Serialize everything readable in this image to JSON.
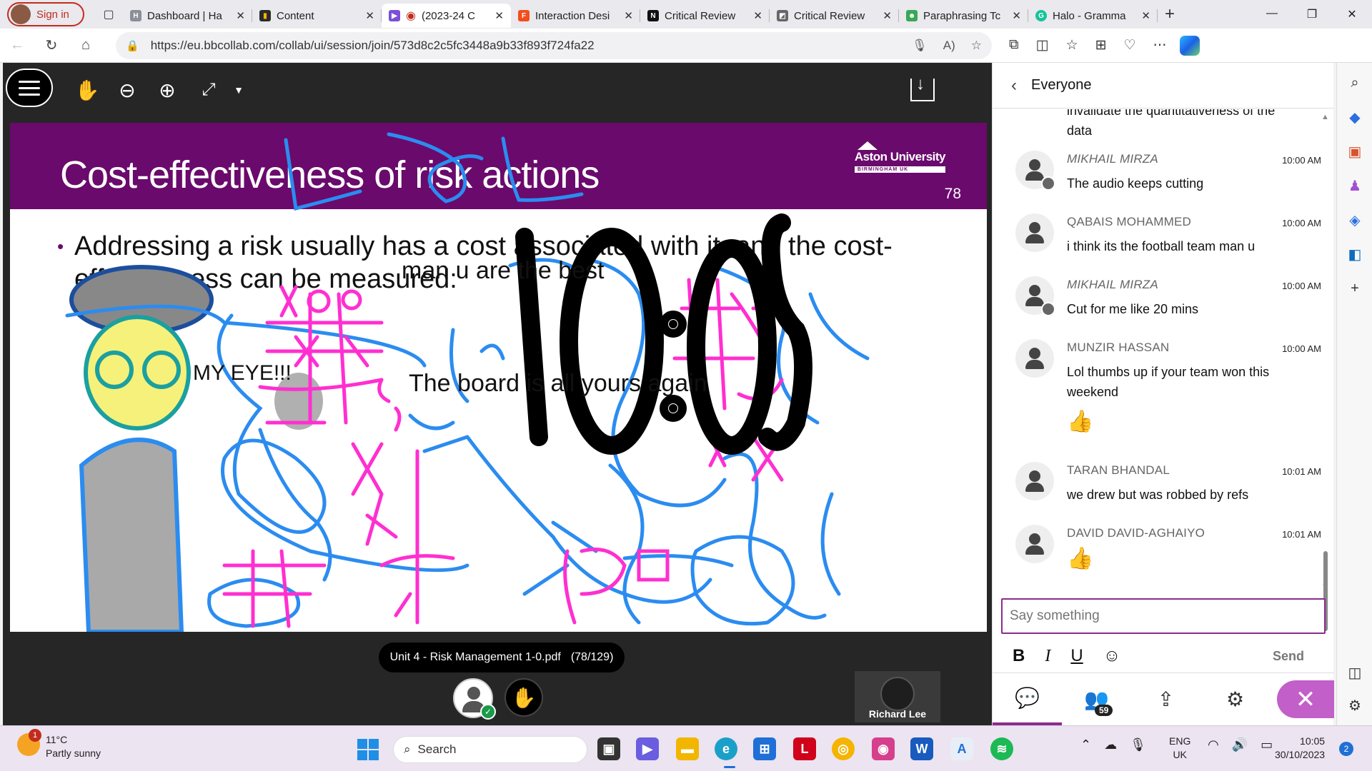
{
  "browser": {
    "profile_label": "Sign in",
    "tabs": [
      {
        "label": "Dashboard | Ha",
        "color": "#8a8f98"
      },
      {
        "label": "Content",
        "color": "#2a2a2a"
      },
      {
        "label": "(2023-24 C",
        "color": "#7b4fd6"
      },
      {
        "label": "Interaction Desi",
        "color": "#f24e1e"
      },
      {
        "label": "Critical Review",
        "color": "#111111"
      },
      {
        "label": "Critical Review",
        "color": "#666666"
      },
      {
        "label": "Paraphrasing Tc",
        "color": "#3aa757"
      },
      {
        "label": "Halo - Gramma",
        "color": "#15c39a"
      }
    ],
    "url": "https://eu.bbcollab.com/collab/ui/session/join/573d8c2c5fc3448a9b33f893f724fa22"
  },
  "slide": {
    "title": "Cost-effectiveness of risk actions",
    "university": "Aston University",
    "university_sub": "BIRMINGHAM UK",
    "slide_number": "78",
    "bullet": "Addressing a risk usually has a cost associated with it, and the cost-effectiveness can be measured:",
    "annotations": {
      "man_u": "man u are the best",
      "my_eye": "MY EYE!!!",
      "board": "The board is all yours again",
      "clock_drawing": "10:05"
    },
    "colors": {
      "header": "#6a0a6c",
      "ink_blue": "#2b8cf0",
      "ink_pink": "#ff2fd0"
    }
  },
  "collab": {
    "file_name": "Unit 4 - Risk Management 1-0.pdf",
    "page_indicator": "(78/129)",
    "speaker_name": "Richard Lee"
  },
  "chat": {
    "title": "Everyone",
    "partial_text": "invalidate the quantitativeness of the data",
    "messages": [
      {
        "name": "MIKHAIL MIRZA",
        "time": "10:00 AM",
        "text": "The audio keeps cutting",
        "moderator": true
      },
      {
        "name": "QABAIS MOHAMMED",
        "time": "10:00 AM",
        "text": "i think its the football team man u",
        "moderator": false
      },
      {
        "name": "MIKHAIL MIRZA",
        "time": "10:00 AM",
        "text": "Cut for me like 20 mins",
        "moderator": true
      },
      {
        "name": "MUNZIR HASSAN",
        "time": "10:00 AM",
        "text": "Lol thumbs up if your team won this weekend",
        "moderator": false
      },
      {
        "name": "TARAN BHANDAL",
        "time": "10:01 AM",
        "text": "we drew but was robbed by refs",
        "moderator": false
      },
      {
        "name": "DAVID DAVID-AGHAIYO",
        "time": "10:01 AM",
        "text": "",
        "moderator": false
      }
    ],
    "input_placeholder": "Say something",
    "format_bold": "B",
    "format_italic": "I",
    "format_underline": "U",
    "send_label": "Send",
    "attendee_count": "59"
  },
  "taskbar": {
    "temperature": "11°C",
    "weather": "Partly sunny",
    "weather_badge": "1",
    "search_label": "Search",
    "lang1": "ENG",
    "lang2": "UK",
    "time": "10:05",
    "date": "30/10/2023",
    "notification_count": "2"
  }
}
